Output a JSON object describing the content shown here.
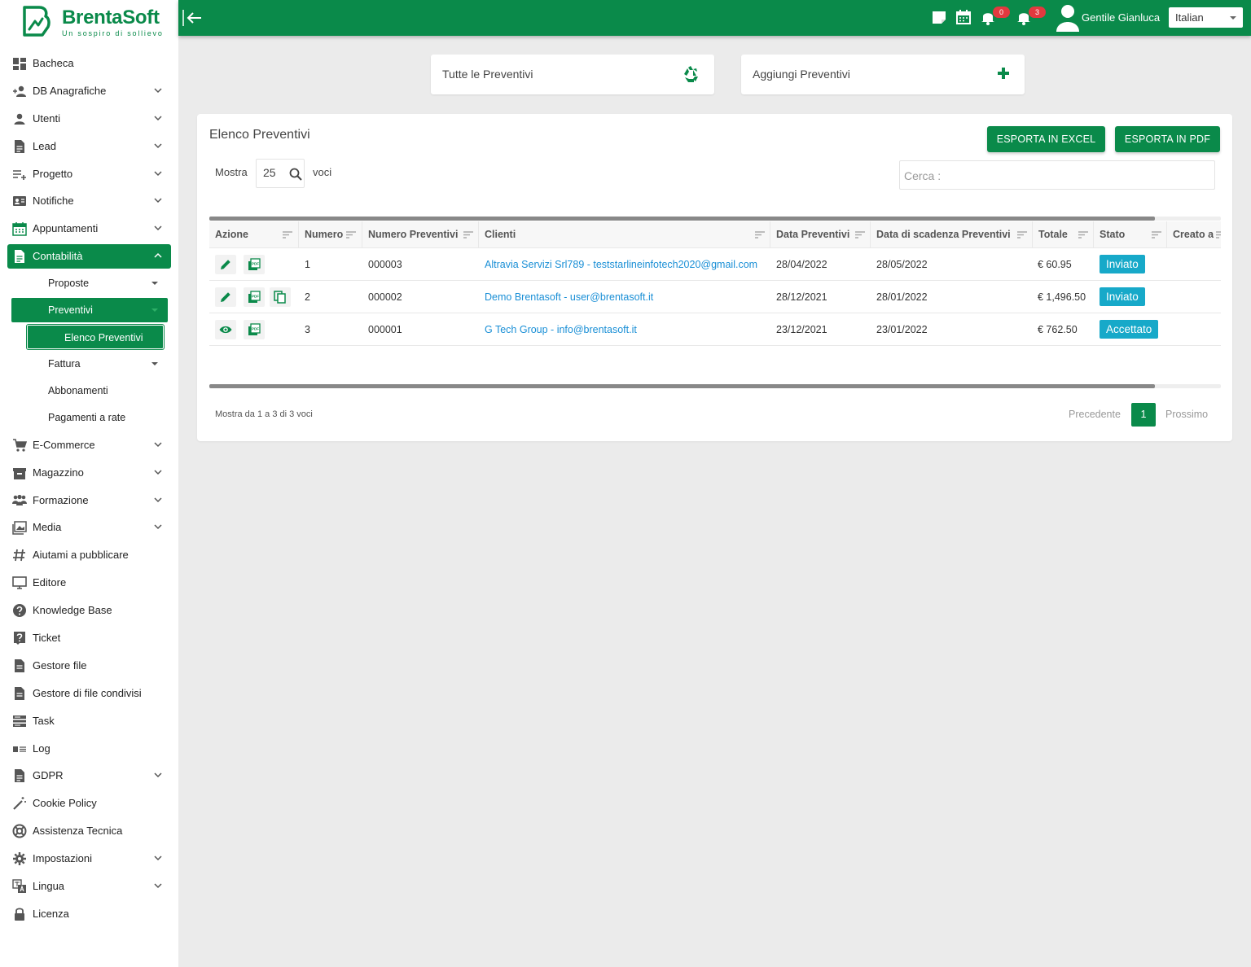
{
  "brand": {
    "name": "BrentaSoft",
    "tagline": "Un sospiro di sollievo"
  },
  "topbar": {
    "badge1": "0",
    "badge2": "3",
    "user": "Gentile Gianluca",
    "lang": "Italian"
  },
  "sidebar": {
    "items": [
      {
        "key": "bacheca",
        "label": "Bacheca",
        "chev": false
      },
      {
        "key": "db-anagrafiche",
        "label": "DB Anagrafiche",
        "chev": true
      },
      {
        "key": "utenti",
        "label": "Utenti",
        "chev": true
      },
      {
        "key": "lead",
        "label": "Lead",
        "chev": true
      },
      {
        "key": "progetto",
        "label": "Progetto",
        "chev": true
      },
      {
        "key": "notifiche",
        "label": "Notifiche",
        "chev": true
      },
      {
        "key": "appuntamenti",
        "label": "Appuntamenti",
        "chev": true
      },
      {
        "key": "contabilita",
        "label": "Contabilità",
        "chev": true
      },
      {
        "key": "ecommerce",
        "label": "E-Commerce",
        "chev": true
      },
      {
        "key": "magazzino",
        "label": "Magazzino",
        "chev": true
      },
      {
        "key": "formazione",
        "label": "Formazione",
        "chev": true
      },
      {
        "key": "media",
        "label": "Media",
        "chev": true
      },
      {
        "key": "aiutami",
        "label": "Aiutami a pubblicare",
        "chev": false
      },
      {
        "key": "editore",
        "label": "Editore",
        "chev": false
      },
      {
        "key": "knowledge",
        "label": "Knowledge Base",
        "chev": false
      },
      {
        "key": "ticket",
        "label": "Ticket",
        "chev": false
      },
      {
        "key": "gestore-file",
        "label": "Gestore file",
        "chev": false
      },
      {
        "key": "gestore-condivisi",
        "label": "Gestore di file condivisi",
        "chev": false
      },
      {
        "key": "task",
        "label": "Task",
        "chev": false
      },
      {
        "key": "log",
        "label": "Log",
        "chev": false
      },
      {
        "key": "gdpr",
        "label": "GDPR",
        "chev": true
      },
      {
        "key": "cookie",
        "label": "Cookie Policy",
        "chev": false
      },
      {
        "key": "assistenza",
        "label": "Assistenza Tecnica",
        "chev": false
      },
      {
        "key": "impostazioni",
        "label": "Impostazioni",
        "chev": true
      },
      {
        "key": "lingua",
        "label": "Lingua",
        "chev": true
      },
      {
        "key": "licenza",
        "label": "Licenza",
        "chev": false
      }
    ],
    "sub": {
      "proposte": "Proposte",
      "preventivi": "Preventivi",
      "elenco": "Elenco Preventivi",
      "fattura": "Fattura",
      "abbonamenti": "Abbonamenti",
      "pagamenti": "Pagamenti a rate"
    }
  },
  "cards": {
    "all": "Tutte le Preventivi",
    "add": "Aggiungi Preventivi"
  },
  "panel": {
    "title": "Elenco Preventivi",
    "excel": "ESPORTA IN EXCEL",
    "pdf": "ESPORTA IN PDF",
    "show": "Mostra",
    "count": "25",
    "entries": "voci",
    "search_label": "Cerca :"
  },
  "table": {
    "headers": [
      "Azione",
      "Numero",
      "Numero Preventivi",
      "Clienti",
      "Data Preventivi",
      "Data di scadenza Preventivi",
      "Totale",
      "Stato",
      "Creato a"
    ],
    "rows": [
      {
        "num": "1",
        "code": "000003",
        "client": "Altravia Servizi Srl789 - teststarlineinfotech2020@gmail.com",
        "date": "28/04/2022",
        "due": "28/05/2022",
        "total": "€ 60.95",
        "status": "Inviato"
      },
      {
        "num": "2",
        "code": "000002",
        "client": "Demo Brentasoft - user@brentasoft.it",
        "date": "28/12/2021",
        "due": "28/01/2022",
        "total": "€ 1,496.50",
        "status": "Inviato"
      },
      {
        "num": "3",
        "code": "000001",
        "client": "G Tech Group - info@brentasoft.it",
        "date": "23/12/2021",
        "due": "23/01/2022",
        "total": "€ 762.50",
        "status": "Accettato"
      }
    ]
  },
  "footer": {
    "info": "Mostra da 1 a 3 di 3 voci",
    "prev": "Precedente",
    "page": "1",
    "next": "Prossimo"
  },
  "colors": {
    "primary": "#0a8a4a",
    "link": "#1a8fd6",
    "status": "#17a9c9"
  }
}
